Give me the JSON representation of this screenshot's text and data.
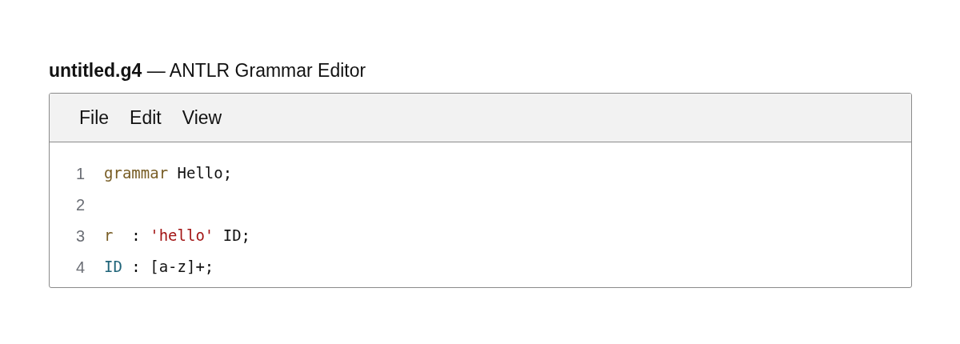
{
  "window": {
    "title": "**untitled.g4** — ANTLR Grammar Editor"
  },
  "menu": [
    "File",
    "Edit",
    "View"
  ],
  "editor": {
    "lines": [
      {
        "number": "1",
        "tokens": [
          {
            "text": "grammar",
            "kind": "keyword"
          },
          {
            "text": " Hello;",
            "kind": "plain"
          }
        ]
      },
      {
        "number": "2"
      },
      {
        "number": "3",
        "tokens": [
          {
            "text": "r",
            "kind": "rule"
          },
          {
            "text": "  : ",
            "kind": "plain"
          },
          {
            "text": "'hello'",
            "kind": "string"
          },
          {
            "text": " ID;",
            "kind": "plain"
          }
        ]
      },
      {
        "number": "4",
        "tokens": [
          {
            "text": "ID",
            "kind": "token"
          },
          {
            "text": " : [a-z]+;",
            "kind": "plain"
          }
        ]
      }
    ]
  }
}
